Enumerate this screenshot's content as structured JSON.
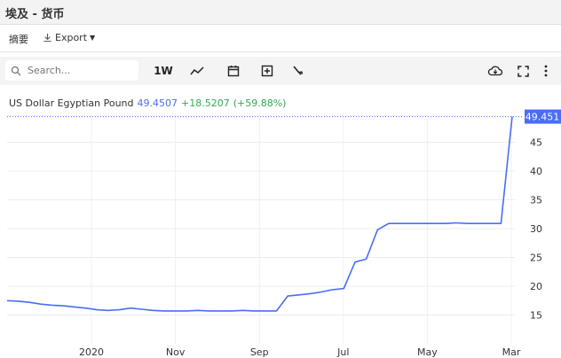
{
  "window": {
    "title": "埃及 - 货币"
  },
  "tabs": {
    "summary": "摘要",
    "export": "Export"
  },
  "toolbar": {
    "search_placeholder": "Search...",
    "interval": "1W"
  },
  "legend": {
    "symbol": "US Dollar Egyptian Pound",
    "price": "49.4507",
    "change": "+18.5207",
    "change_pct": "(+59.88%)"
  },
  "price_tag": "49.451",
  "colors": {
    "line": "#4a6cf7",
    "change": "#34a853"
  },
  "icons": [
    "search-icon",
    "download-icon",
    "line-chart-icon",
    "calendar-icon",
    "add-indicator-icon",
    "wrench-icon",
    "cloud-download-icon",
    "fullscreen-icon",
    "more-icon"
  ],
  "chart_data": {
    "type": "line",
    "title": "",
    "xlabel": "",
    "ylabel": "",
    "ylim": [
      10,
      50
    ],
    "yticks": [
      15,
      20,
      25,
      30,
      35,
      40,
      45
    ],
    "xticks": [
      "2020",
      "Nov",
      "Sep",
      "Jul",
      "May",
      "Mar"
    ],
    "grid": true,
    "series": [
      {
        "name": "US Dollar Egyptian Pound",
        "values": [
          17.5,
          17.4,
          17.2,
          16.9,
          16.7,
          16.6,
          16.4,
          16.2,
          15.9,
          15.8,
          15.9,
          16.2,
          16.0,
          15.8,
          15.7,
          15.7,
          15.7,
          15.8,
          15.7,
          15.7,
          15.7,
          15.8,
          15.7,
          15.7,
          15.7,
          18.3,
          18.5,
          18.7,
          19.0,
          19.4,
          19.6,
          24.2,
          24.7,
          29.8,
          30.9,
          30.9,
          30.9,
          30.9,
          30.9,
          30.9,
          31.0,
          30.9,
          30.9,
          30.9,
          30.9,
          49.45
        ]
      }
    ]
  }
}
